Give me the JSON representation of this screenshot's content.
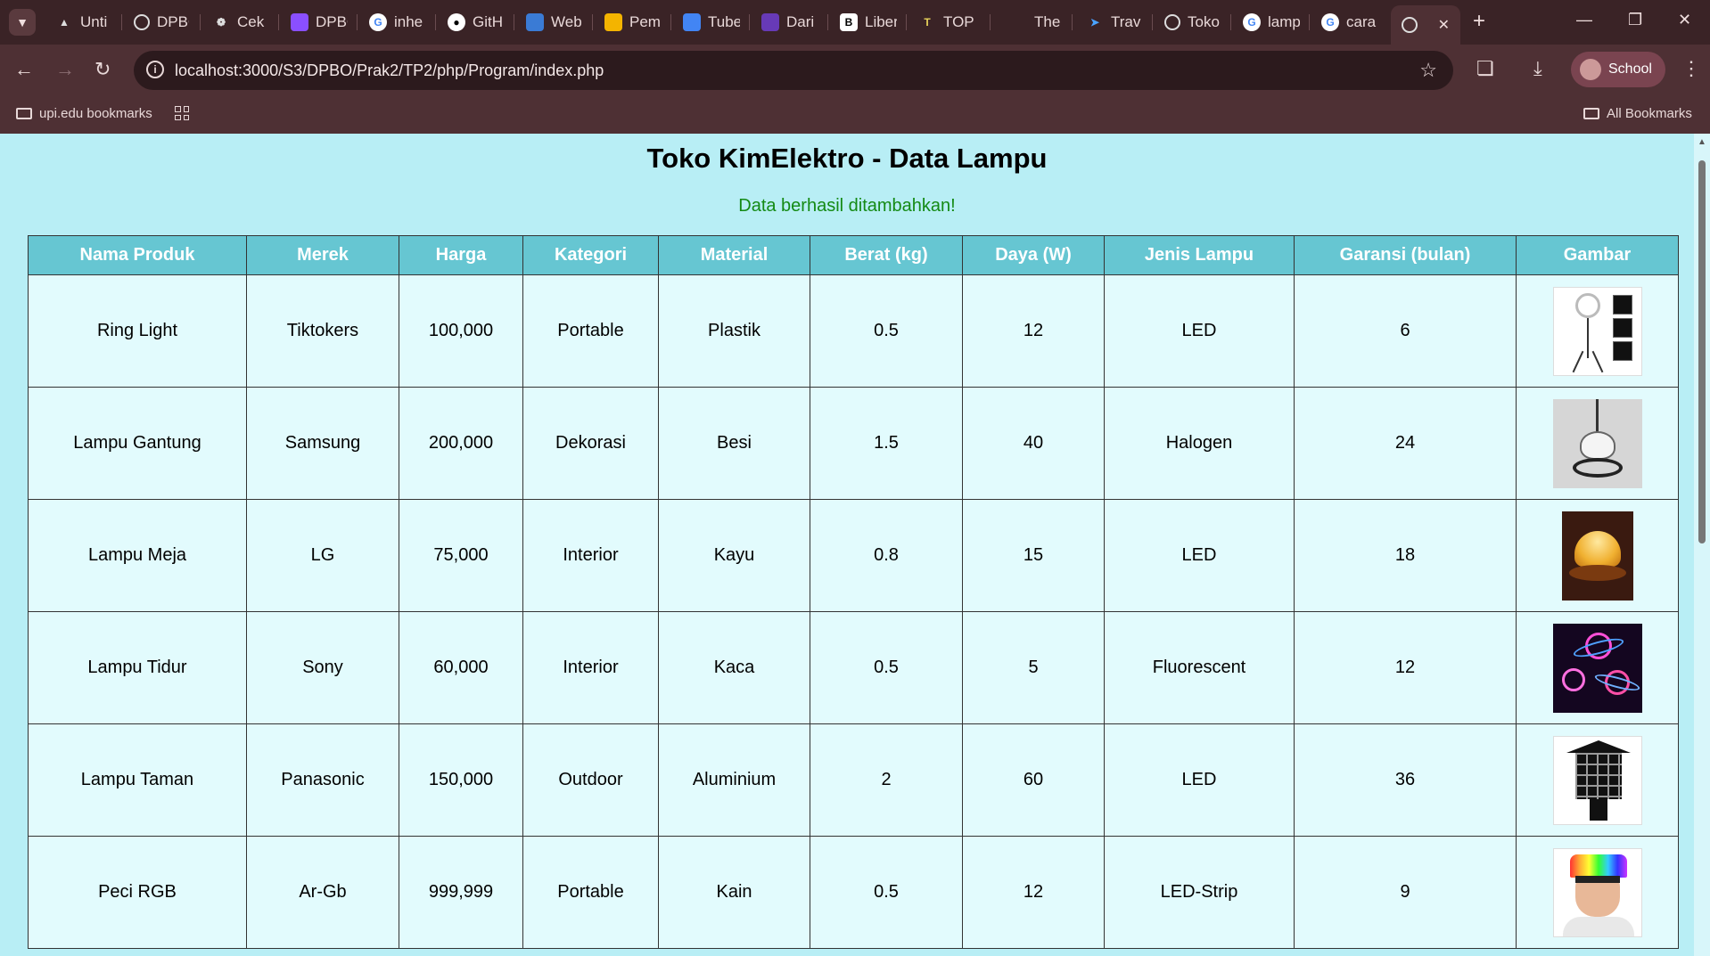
{
  "browser": {
    "tabs": [
      {
        "title": "Unti",
        "icon": "drive-icon",
        "color": "#3a2326"
      },
      {
        "title": "DPBO",
        "icon": "globe-icon",
        "color": "#3a2326"
      },
      {
        "title": "Cek",
        "icon": "openai-icon",
        "color": "#3a2326"
      },
      {
        "title": "DPBO",
        "icon": "chat-icon",
        "color": "#3a2326"
      },
      {
        "title": "inhe",
        "icon": "google-icon",
        "color": "#3a2326"
      },
      {
        "title": "GitH",
        "icon": "github-icon",
        "color": "#3a2326"
      },
      {
        "title": "Web",
        "icon": "classroom-icon",
        "color": "#3a2326"
      },
      {
        "title": "Pem",
        "icon": "slides-icon",
        "color": "#3a2326"
      },
      {
        "title": "Tube",
        "icon": "docs-icon",
        "color": "#3a2326"
      },
      {
        "title": "Dari",
        "icon": "forms-icon",
        "color": "#3a2326"
      },
      {
        "title": "Liber",
        "icon": "book-icon",
        "color": "#3a2326"
      },
      {
        "title": "TOP",
        "icon": "tp-icon",
        "color": "#3a2326"
      },
      {
        "title": "The",
        "icon": "blank-icon",
        "color": "#3a2326"
      },
      {
        "title": "Trav",
        "icon": "bird-icon",
        "color": "#3a2326"
      },
      {
        "title": "Toko",
        "icon": "globe-icon",
        "color": "#3a2326"
      },
      {
        "title": "lamp",
        "icon": "google-icon",
        "color": "#3a2326"
      },
      {
        "title": "cara",
        "icon": "google-icon",
        "color": "#3a2326"
      },
      {
        "title": "",
        "icon": "globe-icon",
        "color": "#4e3034",
        "active": true
      }
    ],
    "url": "localhost:3000/S3/DPBO/Prak2/TP2/php/Program/index.php",
    "profile_label": "School",
    "bookmarks": {
      "folder_label": "upi.edu bookmarks",
      "all_label": "All Bookmarks"
    }
  },
  "page": {
    "title": "Toko KimElektro - Data Lampu",
    "flash_message": "Data berhasil ditambahkan!",
    "colors": {
      "background": "#b8eef5",
      "header_bg": "#66c6d2",
      "cell_bg": "#e2fbfd",
      "flash": "#148a14"
    },
    "table": {
      "headers": [
        "Nama Produk",
        "Merek",
        "Harga",
        "Kategori",
        "Material",
        "Berat (kg)",
        "Daya (W)",
        "Jenis Lampu",
        "Garansi (bulan)",
        "Gambar"
      ],
      "rows": [
        {
          "nama": "Ring Light",
          "merek": "Tiktokers",
          "harga": "100,000",
          "kategori": "Portable",
          "material": "Plastik",
          "berat": "0.5",
          "daya": "12",
          "jenis": "LED",
          "garansi": "6",
          "gambar": "ring-light"
        },
        {
          "nama": "Lampu Gantung",
          "merek": "Samsung",
          "harga": "200,000",
          "kategori": "Dekorasi",
          "material": "Besi",
          "berat": "1.5",
          "daya": "40",
          "jenis": "Halogen",
          "garansi": "24",
          "gambar": "lampu-gantung"
        },
        {
          "nama": "Lampu Meja",
          "merek": "LG",
          "harga": "75,000",
          "kategori": "Interior",
          "material": "Kayu",
          "berat": "0.8",
          "daya": "15",
          "jenis": "LED",
          "garansi": "18",
          "gambar": "lampu-meja"
        },
        {
          "nama": "Lampu Tidur",
          "merek": "Sony",
          "harga": "60,000",
          "kategori": "Interior",
          "material": "Kaca",
          "berat": "0.5",
          "daya": "5",
          "jenis": "Fluorescent",
          "garansi": "12",
          "gambar": "lampu-tidur"
        },
        {
          "nama": "Lampu Taman",
          "merek": "Panasonic",
          "harga": "150,000",
          "kategori": "Outdoor",
          "material": "Aluminium",
          "berat": "2",
          "daya": "60",
          "jenis": "LED",
          "garansi": "36",
          "gambar": "lampu-taman"
        },
        {
          "nama": "Peci RGB",
          "merek": "Ar-Gb",
          "harga": "999,999",
          "kategori": "Portable",
          "material": "Kain",
          "berat": "0.5",
          "daya": "12",
          "jenis": "LED-Strip",
          "garansi": "9",
          "gambar": "peci-rgb"
        }
      ]
    }
  }
}
